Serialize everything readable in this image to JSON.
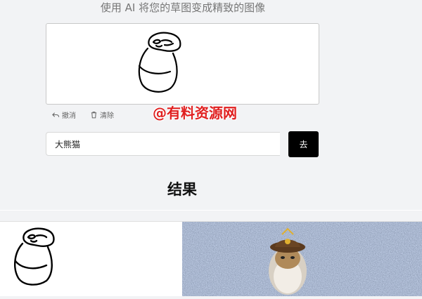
{
  "header": {
    "subtitle": "使用 AI 将您的草图变成精致的图像"
  },
  "toolbar": {
    "undo_label": "撤消",
    "clear_label": "清除"
  },
  "watermark": {
    "text": "@有料资源网"
  },
  "prompt": {
    "value": "大熊猫",
    "button_label": "去"
  },
  "results": {
    "heading": "结果"
  },
  "colors": {
    "button_bg": "#000000",
    "page_bg": "#f2f3f5",
    "watermark": "#e02020",
    "carpet_base": "#5a6f95"
  },
  "icons": {
    "undo": "undo-icon",
    "clear": "trash-icon"
  }
}
